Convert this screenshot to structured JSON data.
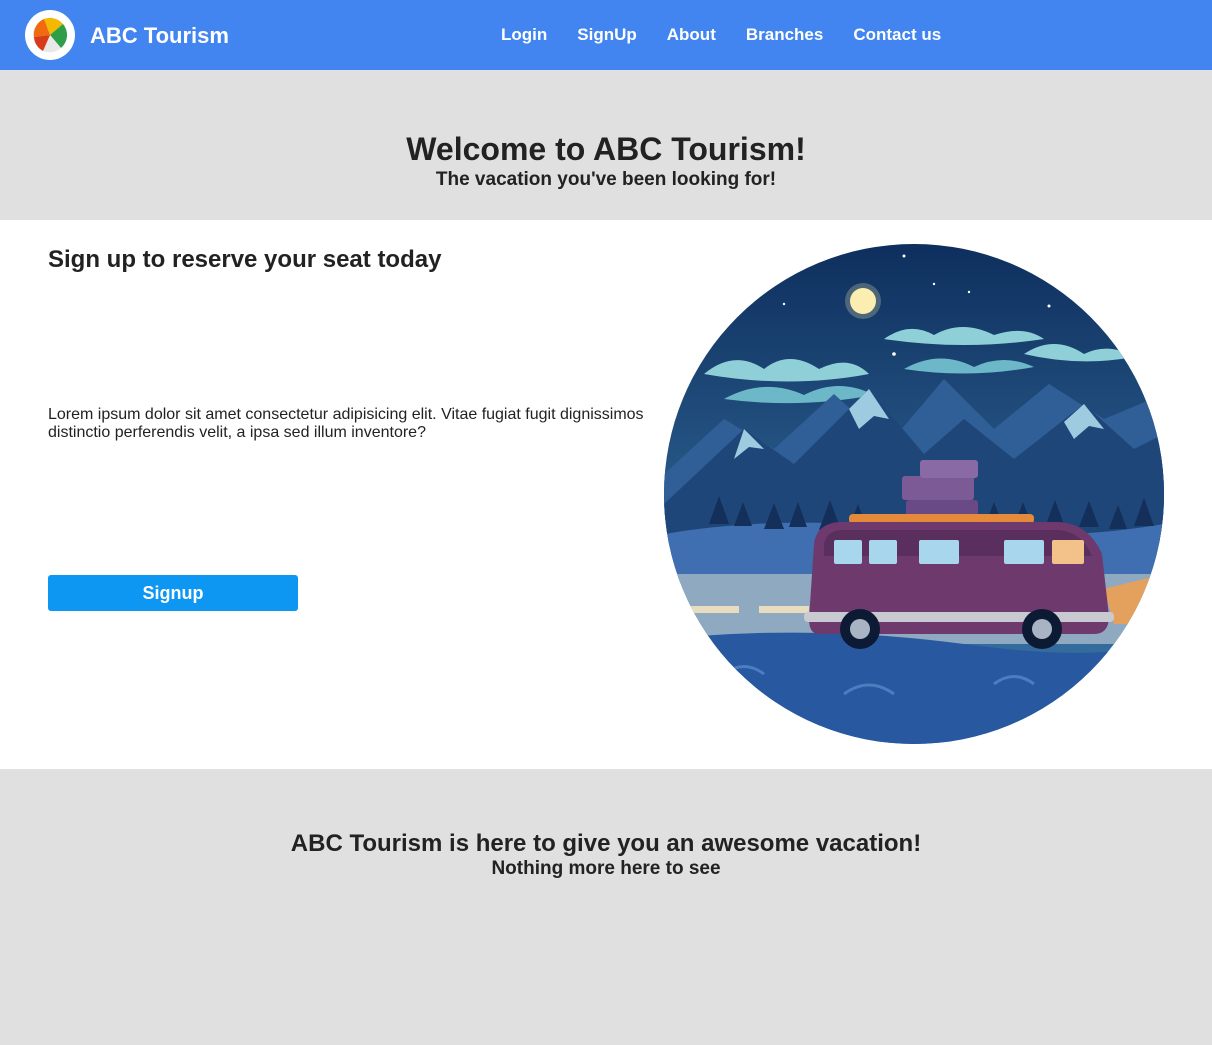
{
  "header": {
    "logo_icon": "beach-ball-icon",
    "brand": "ABC Tourism",
    "nav": [
      "Login",
      "SignUp",
      "About",
      "Branches",
      "Contact us"
    ],
    "color": "#4285f0"
  },
  "hero": {
    "title": "Welcome to ABC Tourism!",
    "subtitle": "The vacation you've been looking for!"
  },
  "main": {
    "heading": "Sign up to reserve your seat today",
    "text": "Lorem ipsum dolor sit amet consectetur adipisicing elit. Vitae fugiat fugit dignissimos distinctio perferendis velit, a ipsa sed illum inventore?",
    "button": "Signup",
    "button_color": "#0d96f2",
    "image": "night-road-trip-van-illustration"
  },
  "footer": {
    "title": "ABC Tourism is here to give you an awesome vacation!",
    "subtitle": "Nothing more here to see"
  }
}
